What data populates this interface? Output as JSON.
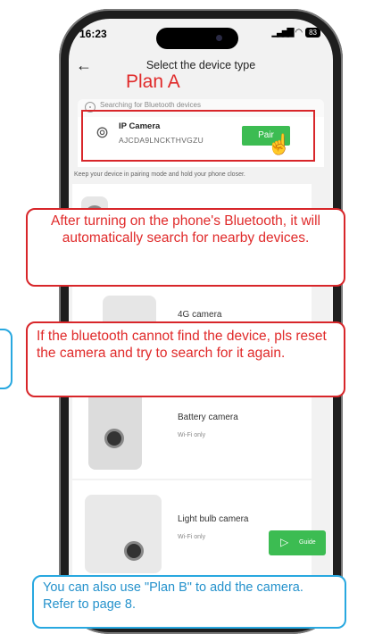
{
  "status_bar": {
    "time": "16:23",
    "battery": "83"
  },
  "header": {
    "back_icon": "arrow-left-icon",
    "title": "Select the device type"
  },
  "annotations": {
    "plan_a": "Plan A",
    "callout_1": "After turning on the phone's Bluetooth, it will automatically search for nearby devices.",
    "callout_2": "If the bluetooth cannot find the device, pls reset the camera and try to search for it again.",
    "callout_3": "You can also use \"Plan B\" to add the camera. Refer to page 8."
  },
  "bluetooth": {
    "searching_text": "Searching for Bluetooth devices"
  },
  "found_device": {
    "name": "IP Camera",
    "id": "AJCDA9LNCKTHVGZU",
    "pair_label": "Pair",
    "icon": "camera-icon"
  },
  "hint_text": "Keep your device in pairing mode and hold your phone closer.",
  "device_types": [
    {
      "label": "",
      "sub": ""
    },
    {
      "label": "4G camera",
      "sub": ""
    },
    {
      "label": "Battery camera",
      "sub": "Wi-Fi only"
    },
    {
      "label": "Light bulb camera",
      "sub": "Wi-Fi only"
    }
  ],
  "guide_button": {
    "label": "Guide"
  },
  "colors": {
    "accent_red": "#d8262a",
    "pair_green": "#3cbc52",
    "callout_blue": "#28a8e0"
  }
}
